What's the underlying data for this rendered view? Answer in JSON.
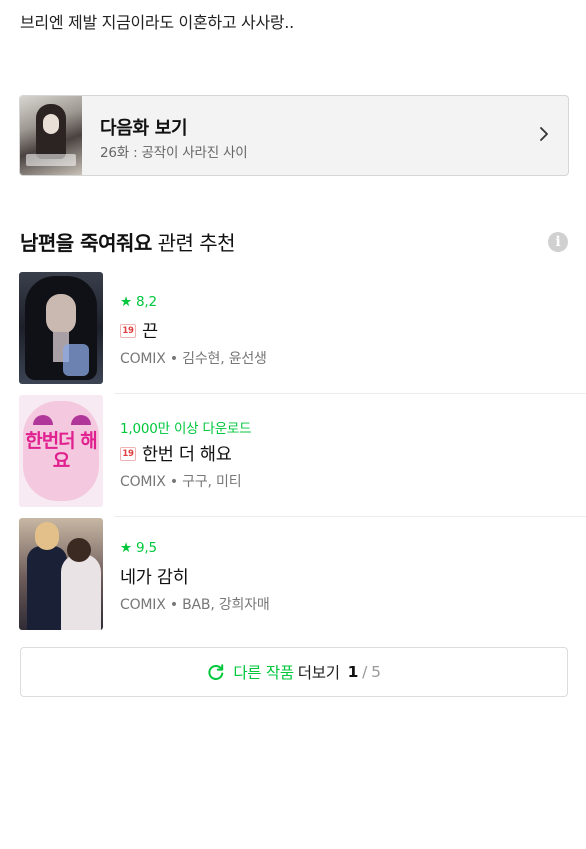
{
  "comment": {
    "text": "브리엔 제발 지금이라도 이혼하고  사사랑.."
  },
  "next_episode": {
    "title": "다음화 보기",
    "subtitle": "26화 : 공작이 사라진 사이"
  },
  "recommendations": {
    "title_bold": "남편을 죽여줘요",
    "title_rest": " 관련 추천",
    "items": [
      {
        "meta": "★ 8,2",
        "age_badge": "19",
        "title": "끈",
        "author": "COMIX • 김수현, 윤선생"
      },
      {
        "meta": "1,000만 이상 다운로드",
        "age_badge": "19",
        "title": "한번 더 해요",
        "author": "COMIX • 구구, 미티",
        "cover_text": "한번더 해요"
      },
      {
        "meta": "★ 9,5",
        "title": "네가 감히",
        "author": "COMIX • BAB, 강희자매"
      }
    ]
  },
  "more_button": {
    "label_green": "다른 작품",
    "label_black": "더보기",
    "page_current": "1",
    "page_separator": "/",
    "page_total": "5"
  },
  "colors": {
    "accent_green": "#00c73c",
    "age_badge_red": "#e23c3c"
  },
  "icons": [
    "chevron-right-icon",
    "info-icon",
    "refresh-icon"
  ]
}
